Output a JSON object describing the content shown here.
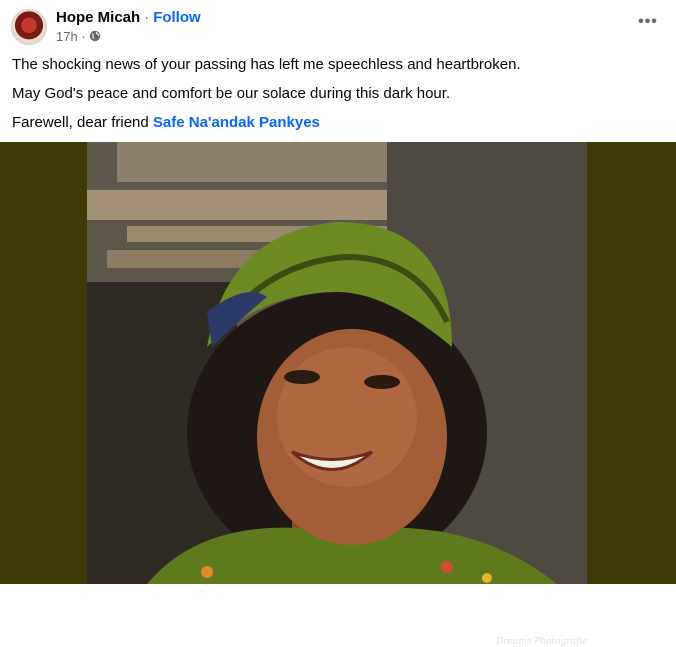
{
  "post": {
    "author": "Hope Micah",
    "separator": "·",
    "follow_label": "Follow",
    "time": "17h",
    "privacy_icon": "globe-icon",
    "more_icon": "more-dots-icon",
    "more_label": "•••",
    "lines": [
      "The shocking news of your passing has left me speechless and heartbroken.",
      "May God's peace and comfort be our solace during this dark hour."
    ],
    "farewell_prefix": "Farewell, dear friend ",
    "tagged_name": "Safe Na'andak Pankyes"
  },
  "photo": {
    "watermark": "Dreams Photografie",
    "frame_color": "#403b06"
  },
  "colors": {
    "link": "#0866ff",
    "secondary_text": "#65676b"
  }
}
